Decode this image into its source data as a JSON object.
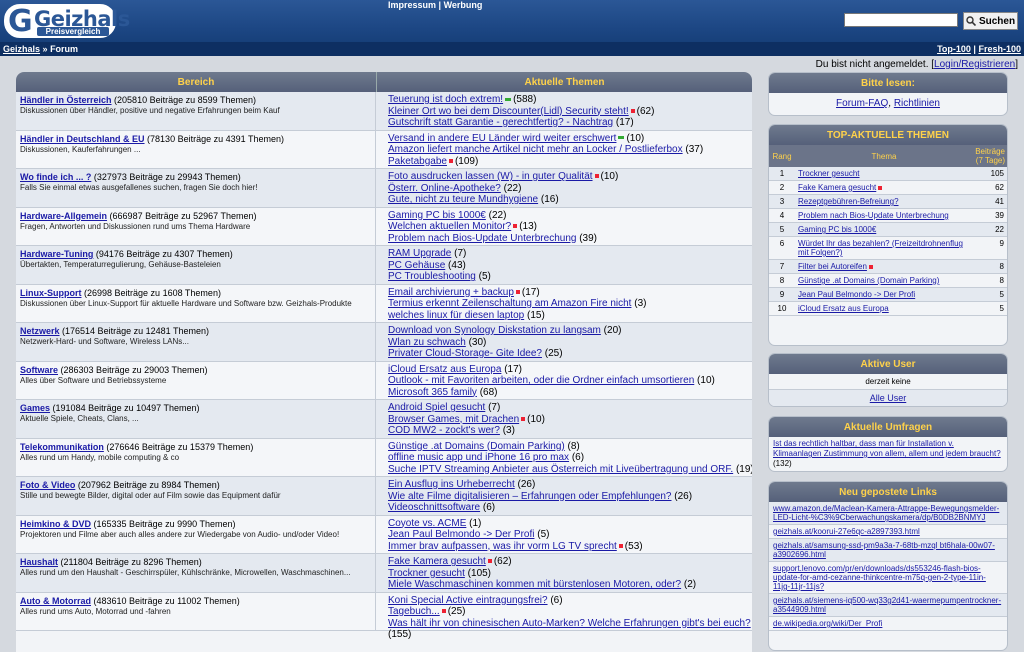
{
  "header": {
    "logo_name": "Geizhals",
    "logo_sub": "Preisvergleich",
    "impressum": "Impressum",
    "sep": "|",
    "werbung": "Werbung",
    "search_button": "Suchen",
    "search_value": ""
  },
  "nav": {
    "home": "Geizhals",
    "crumb_sep": "»",
    "current": "Forum",
    "top100": "Top-100",
    "pipe": "|",
    "fresh100": "Fresh-100"
  },
  "login": {
    "text": "Du bist nicht angemeldet. [",
    "link": "Login/Registrieren",
    "close": "]"
  },
  "main": {
    "col_bereich": "Bereich",
    "col_themen": "Aktuelle Themen",
    "forums": [
      {
        "name": "Händler in Österreich",
        "stats": "(205810 Beiträge zu 8599 Themen)",
        "desc": "Diskussionen über Händler, positive und negative Erfahrungen beim Kauf",
        "topics": [
          {
            "t": "Teuerung ist doch extrem!",
            "c": "(588)",
            "m": "g"
          },
          {
            "t": "Kleiner Ort wo bei dem Discounter(Lidl) Security steht!",
            "c": "(62)",
            "m": "r"
          },
          {
            "t": "Gutschrift statt Garantie - gerechtfertig? - Nachtrag",
            "c": "(17)",
            "m": ""
          }
        ]
      },
      {
        "name": "Händler in Deutschland & EU",
        "stats": "(78130 Beiträge zu 4391 Themen)",
        "desc": "Diskussionen, Kauferfahrungen ...",
        "topics": [
          {
            "t": "Versand in andere EU Länder wird weiter erschwert",
            "c": "(10)",
            "m": "g"
          },
          {
            "t": "Amazon liefert manche Artikel nicht mehr an Locker / Postlieferbox",
            "c": "(37)",
            "m": ""
          },
          {
            "t": "Paketabgabe",
            "c": "(109)",
            "m": "r"
          }
        ]
      },
      {
        "name": "Wo finde ich ... ?",
        "stats": "(327973 Beiträge zu 29943 Themen)",
        "desc": "Falls Sie einmal etwas ausgefallenes suchen, fragen Sie doch hier!",
        "topics": [
          {
            "t": "Foto ausdrucken lassen (W) - in guter Qualität",
            "c": "(10)",
            "m": "r"
          },
          {
            "t": "Österr. Online-Apotheke?",
            "c": "(22)",
            "m": ""
          },
          {
            "t": "Gute, nicht zu teure Mundhygiene",
            "c": "(16)",
            "m": ""
          }
        ]
      },
      {
        "name": "Hardware-Allgemein",
        "stats": "(666987 Beiträge zu 52967 Themen)",
        "desc": "Fragen, Antworten und Diskussionen rund ums Thema Hardware",
        "topics": [
          {
            "t": "Gaming PC bis 1000€",
            "c": "(22)",
            "m": ""
          },
          {
            "t": "Welchen aktuellen Monitor?",
            "c": "(13)",
            "m": "r"
          },
          {
            "t": "Problem nach Bios-Update Unterbrechung",
            "c": "(39)",
            "m": ""
          }
        ]
      },
      {
        "name": "Hardware-Tuning",
        "stats": "(94176 Beiträge zu 4307 Themen)",
        "desc": "Übertakten, Temperaturregulierung, Gehäuse-Basteleien",
        "topics": [
          {
            "t": "RAM Upgrade",
            "c": "(7)",
            "m": ""
          },
          {
            "t": "PC Gehäuse",
            "c": "(43)",
            "m": ""
          },
          {
            "t": "PC Troubleshooting",
            "c": "(5)",
            "m": ""
          }
        ]
      },
      {
        "name": "Linux-Support",
        "stats": "(26998 Beiträge zu 1608 Themen)",
        "desc": "Diskussionen über Linux-Support für aktuelle Hardware und Software bzw. Geizhals-Produkte",
        "topics": [
          {
            "t": "Email archivierung + backup",
            "c": "(17)",
            "m": "r"
          },
          {
            "t": "Termius erkennt Zeilenschaltung am Amazon Fire nicht",
            "c": "(3)",
            "m": ""
          },
          {
            "t": "welches linux für diesen laptop",
            "c": "(15)",
            "m": ""
          }
        ]
      },
      {
        "name": "Netzwerk",
        "stats": "(176514 Beiträge zu 12481 Themen)",
        "desc": "Netzwerk-Hard- und Software, Wireless LANs...",
        "topics": [
          {
            "t": "Download von Synology Diskstation zu langsam",
            "c": "(20)",
            "m": ""
          },
          {
            "t": "Wlan zu schwach",
            "c": "(30)",
            "m": ""
          },
          {
            "t": "Privater Cloud-Storage- Gite Idee?",
            "c": "(25)",
            "m": ""
          }
        ]
      },
      {
        "name": "Software",
        "stats": "(286303 Beiträge zu 29003 Themen)",
        "desc": "Alles über Software und Betriebssysteme",
        "topics": [
          {
            "t": "iCloud Ersatz aus Europa",
            "c": "(17)",
            "m": ""
          },
          {
            "t": "Outlook - mit Favoriten arbeiten, oder die Ordner einfach umsortieren",
            "c": "(10)",
            "m": ""
          },
          {
            "t": "Microsoft 365 family",
            "c": "(68)",
            "m": ""
          }
        ]
      },
      {
        "name": "Games",
        "stats": "(191084 Beiträge zu 10497 Themen)",
        "desc": "Aktuelle Spiele, Cheats, Clans, ...",
        "topics": [
          {
            "t": "Android Spiel gesucht",
            "c": "(7)",
            "m": ""
          },
          {
            "t": "Browser Games, mit Drachen",
            "c": "(10)",
            "m": "r"
          },
          {
            "t": "COD MW2 - zockt's wer?",
            "c": "(3)",
            "m": ""
          }
        ]
      },
      {
        "name": "Telekommunikation",
        "stats": "(276646 Beiträge zu 15379 Themen)",
        "desc": "Alles rund um Handy, mobile computing & co",
        "topics": [
          {
            "t": "Günstige .at Domains (Domain Parking)",
            "c": "(8)",
            "m": ""
          },
          {
            "t": "offline music app und iPhone 16 pro max",
            "c": "(6)",
            "m": ""
          },
          {
            "t": "Suche IPTV Streaming Anbieter aus Österreich mit Liveübertragung und ORF.",
            "c": "(19)",
            "m": ""
          }
        ]
      },
      {
        "name": "Foto & Video",
        "stats": "(207962 Beiträge zu 8984 Themen)",
        "desc": "Stille und bewegte Bilder, digital oder auf Film sowie das Equipment dafür",
        "topics": [
          {
            "t": "Ein Ausflug ins Urheberrecht",
            "c": "(26)",
            "m": ""
          },
          {
            "t": "Wie alte Filme digitalisieren – Erfahrungen oder Empfehlungen?",
            "c": "(26)",
            "m": ""
          },
          {
            "t": "Videoschnittsoftware",
            "c": "(6)",
            "m": ""
          }
        ]
      },
      {
        "name": "Heimkino & DVD",
        "stats": "(165335 Beiträge zu 9990 Themen)",
        "desc": "Projektoren und Filme aber auch alles andere zur Wiedergabe von Audio- und/oder Video!",
        "topics": [
          {
            "t": "Coyote vs. ACME",
            "c": "(1)",
            "m": ""
          },
          {
            "t": "Jean Paul Belmondo -> Der Profi",
            "c": "(5)",
            "m": ""
          },
          {
            "t": "Immer brav aufpassen, was ihr vorm LG TV sprecht",
            "c": "(53)",
            "m": "r"
          }
        ]
      },
      {
        "name": "Haushalt",
        "stats": "(211804 Beiträge zu 8296 Themen)",
        "desc": "Alles rund um den Haushalt - Geschirrspüler, Kühlschränke, Microwellen, Waschmaschinen...",
        "topics": [
          {
            "t": "Fake Kamera gesucht",
            "c": "(62)",
            "m": "r"
          },
          {
            "t": "Trockner gesucht",
            "c": "(105)",
            "m": ""
          },
          {
            "t": "Miele Waschmaschinen kommen mit bürstenlosen Motoren, oder?",
            "c": "(2)",
            "m": ""
          }
        ]
      },
      {
        "name": "Auto & Motorrad",
        "stats": "(483610 Beiträge zu 11002 Themen)",
        "desc": "Alles rund ums Auto, Motorrad und -fahren",
        "topics": [
          {
            "t": "Koni Special Active eintragungsfrei?",
            "c": "(6)",
            "m": ""
          },
          {
            "t": "Tagebuch...",
            "c": "(25)",
            "m": "r"
          },
          {
            "t": "Was hält ihr von chinesischen Auto-Marken? Welche Erfahrungen gibt's bei euch?",
            "c": "",
            "m": ""
          },
          {
            "t": "",
            "c": "(155)",
            "m": ""
          }
        ]
      }
    ]
  },
  "sidebar": {
    "bitte_title": "Bitte lesen:",
    "faq": "Forum-FAQ",
    "comma": ",",
    "richtlinien": "Richtlinien",
    "top_title": "TOP-AKTUELLE THEMEN",
    "top_cols": [
      "Rang",
      "Thema",
      "Beiträge (7 Tage)"
    ],
    "top": [
      {
        "r": "1",
        "t": "Trockner gesucht",
        "c": "105",
        "m": ""
      },
      {
        "r": "2",
        "t": "Fake Kamera gesucht",
        "c": "62",
        "m": "r"
      },
      {
        "r": "3",
        "t": "Rezeptgebühren-Befreiung?",
        "c": "41",
        "m": ""
      },
      {
        "r": "4",
        "t": "Problem nach Bios-Update Unterbrechung",
        "c": "39",
        "m": ""
      },
      {
        "r": "5",
        "t": "Gaming PC bis 1000€",
        "c": "22",
        "m": ""
      },
      {
        "r": "6",
        "t": "Würdet Ihr das bezahlen? (Freizeitdrohnenflug mit Folgen?)",
        "c": "9",
        "m": ""
      },
      {
        "r": "7",
        "t": "Filter bei Autoreifen",
        "c": "8",
        "m": "r"
      },
      {
        "r": "8",
        "t": "Günstige .at Domains (Domain Parking)",
        "c": "8",
        "m": ""
      },
      {
        "r": "9",
        "t": "Jean Paul Belmondo -> Der Profi",
        "c": "5",
        "m": ""
      },
      {
        "r": "10",
        "t": "iCloud Ersatz aus Europa",
        "c": "5",
        "m": ""
      }
    ],
    "user_title": "Aktive User",
    "user_none": "derzeit keine",
    "user_all": "Alle User",
    "poll_title": "Aktuelle Umfragen",
    "poll_text": "Ist das rechtlich haltbar, dass man für Installation v. Klimaanlagen Zustimmung von allem, allem und jedem braucht?",
    "poll_count": "(132)",
    "links_title": "Neu gepostete Links",
    "links": [
      "www.amazon.de/Maclean-Kamera-Attrappe-Bewegungsmelder-LED-Licht-%C3%9Cberwachungskamera/dp/B0DB2BNMYJ",
      "geizhals.at/koorui-27e6qc-a2897393.html",
      "geizhals.at/samsung-ssd-pm9a3a-7-68tb-mzql bt6hala-00w07-a3902696.html",
      "support.lenovo.com/pr/en/downloads/ds553246-flash-bios-update-for-amd-cezanne-thinkcentre-m75q-gen-2-type-11in-11jg-11jr-11js?",
      "geizhals.at/siemens-iq500-wq33g2d41-waermepumpentrockner-a3544909.html",
      "de.wikipedia.org/wiki/Der_Profi"
    ]
  }
}
